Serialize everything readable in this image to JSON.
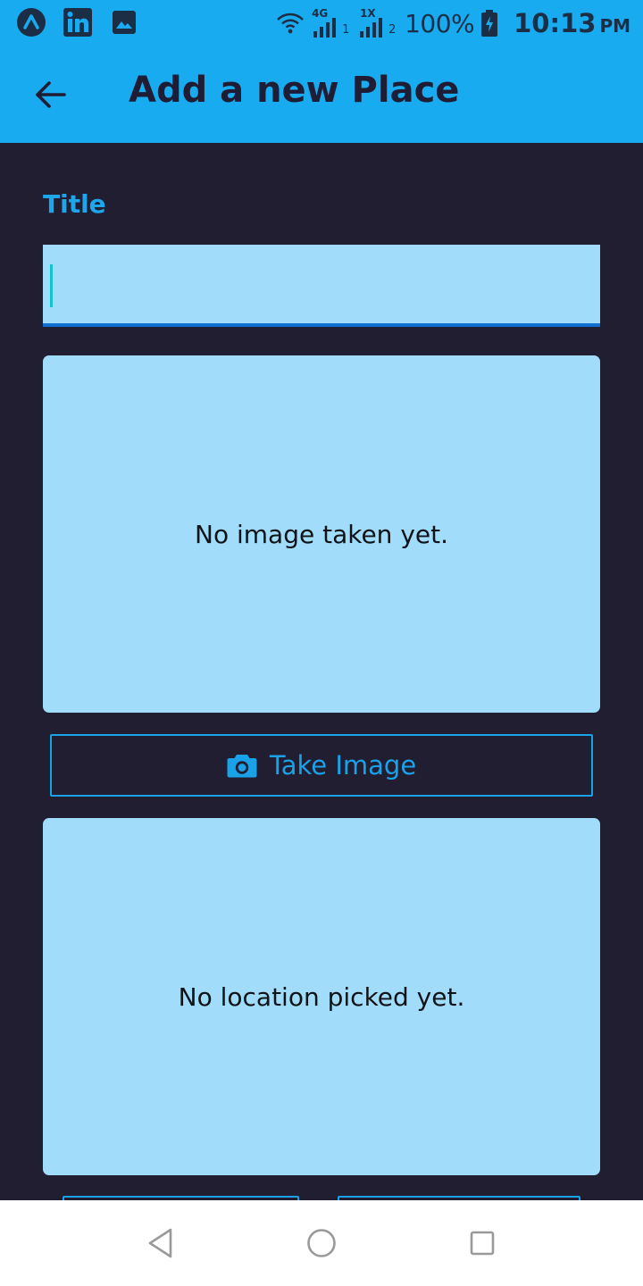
{
  "status_bar": {
    "network_label": "4G",
    "sim1_label": "1",
    "sim2_top_label": "1X",
    "sim2_label": "2",
    "battery": "100%",
    "time": "10:13",
    "ampm": "PM",
    "app_icons": [
      "astrill-icon",
      "linkedin-icon",
      "gallery-icon"
    ]
  },
  "app_bar": {
    "title": "Add a new Place",
    "back_icon": "arrow-back-icon"
  },
  "form": {
    "title_label": "Title",
    "title_value": "",
    "image_placeholder": "No image taken yet.",
    "take_image_label": "Take Image",
    "take_image_icon": "camera-icon",
    "location_placeholder": "No location picked yet."
  },
  "nav_bar": {
    "icons": [
      "back-triangle-icon",
      "home-circle-icon",
      "recents-square-icon"
    ]
  },
  "colors": {
    "primary": "#19abef",
    "background": "#221e32",
    "surface": "#a1dcfa",
    "accent_text": "#1da6ec",
    "underline": "#0f6fd2"
  }
}
